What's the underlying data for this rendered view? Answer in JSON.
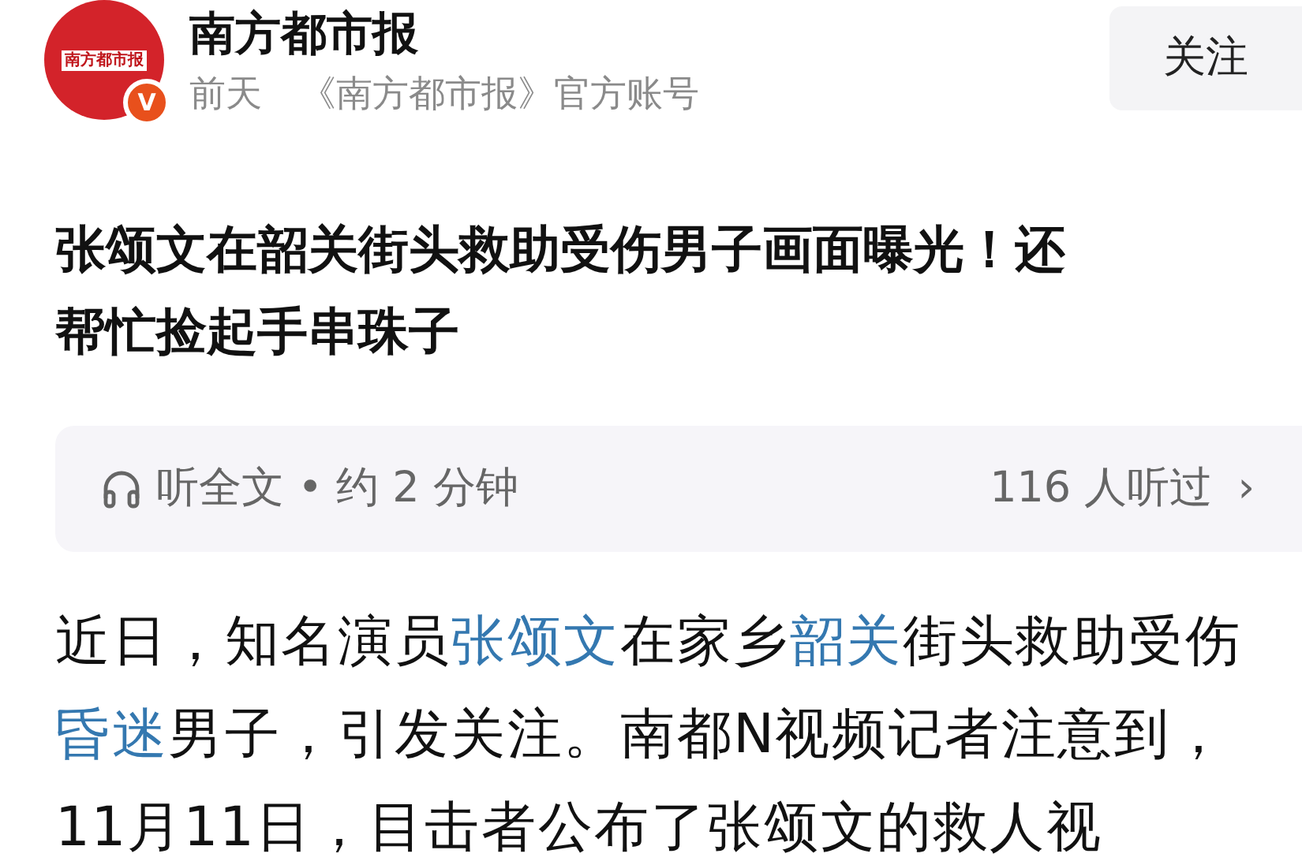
{
  "header": {
    "avatar": {
      "logo_text": "南方都市报",
      "badge": "V"
    },
    "name": "南方都市报",
    "time": "前天",
    "source": "《南方都市报》官方账号",
    "follow_button": "关注"
  },
  "title": "张颂文在韶关街头救助受伤男子画面曝光！还帮忙捡起手串珠子",
  "listen_bar": {
    "label": "听全文 • 约 2 分钟",
    "listeners": "116 人听过",
    "chevron": "›"
  },
  "paragraph": [
    {
      "kind": "text",
      "text": "近日，知名演员"
    },
    {
      "kind": "link",
      "text": "张颂文"
    },
    {
      "kind": "text",
      "text": "在家乡"
    },
    {
      "kind": "link",
      "text": "韶关"
    },
    {
      "kind": "text",
      "text": "街头救助受伤"
    },
    {
      "kind": "link",
      "text": "昏迷"
    },
    {
      "kind": "text",
      "text": "男子，引发关注。南都N视频记者注意到，11月11日，目击者公布了张颂文的救人视"
    }
  ]
}
